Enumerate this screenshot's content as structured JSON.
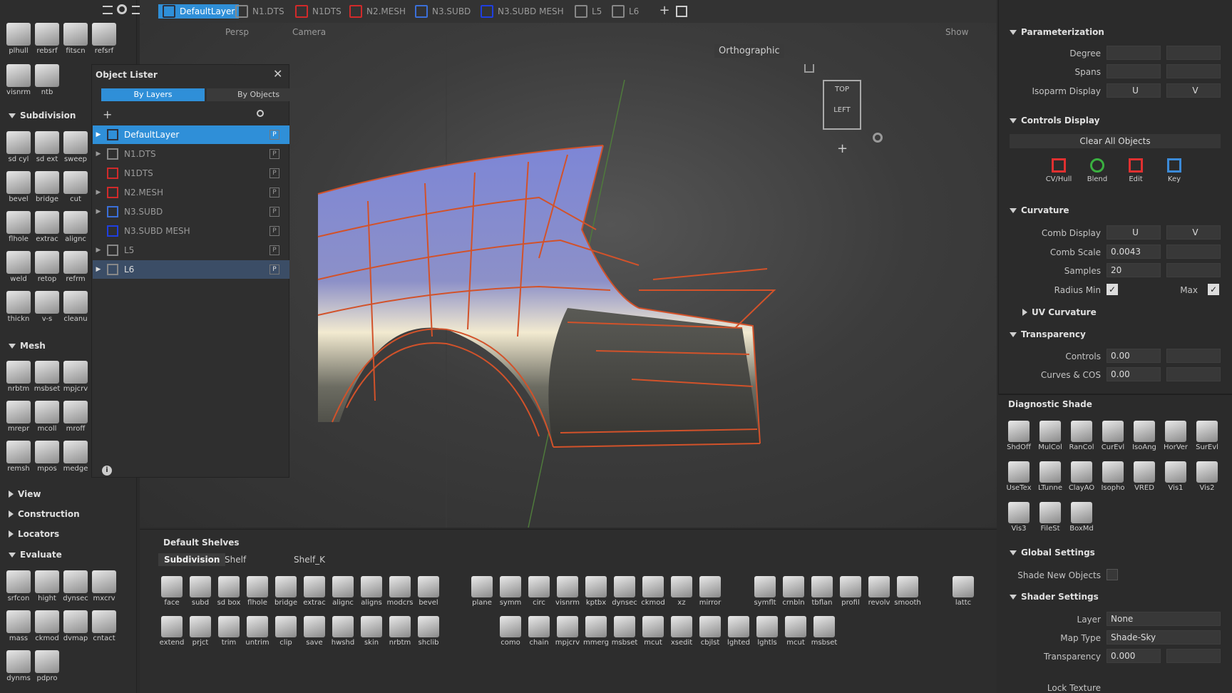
{
  "tabs": [
    {
      "label": "DefaultLayer",
      "color": "#2c2f3c",
      "active": true
    },
    {
      "label": "N1.DTS",
      "color": "#888888"
    },
    {
      "label": "N1DTS",
      "color": "#d12a2a"
    },
    {
      "label": "N2.MESH",
      "color": "#d12a2a"
    },
    {
      "label": "N3.SUBD",
      "color": "#3b6fd8"
    },
    {
      "label": "N3.SUBD MESH",
      "color": "#1f3fe0"
    },
    {
      "label": "L5",
      "color": "#888888"
    },
    {
      "label": "L6",
      "color": "#888888"
    }
  ],
  "viewport": {
    "persp": "Persp",
    "camera": "Camera",
    "show": "Show",
    "ortho": "Orthographic",
    "cube_top": "TOP",
    "cube_left": "LEFT"
  },
  "left_shelf": {
    "row1": [
      "plhull",
      "rebsrf",
      "fitscn",
      "refsrf"
    ],
    "row2": [
      "visnrm",
      "ntb"
    ],
    "subdivision_title": "Subdivision",
    "sub": [
      "sd cyl",
      "sd ext",
      "sweep",
      "bevel",
      "bridge",
      "cut",
      "flhole",
      "extrac",
      "alignc",
      "weld",
      "retop",
      "refrm",
      "thickn",
      "v-s",
      "cleanu"
    ],
    "mesh_title": "Mesh",
    "mesh": [
      "nrbtm",
      "msbset",
      "mpjcrv",
      "mrepr",
      "mcoll",
      "mroff",
      "remsh",
      "mpos",
      "medge"
    ],
    "view": "View",
    "construction": "Construction",
    "locators": "Locators",
    "evaluate_title": "Evaluate",
    "eval": [
      "srfcon",
      "hight",
      "dynsec",
      "mxcrv",
      "mass",
      "ckmod",
      "dvmap",
      "cntact",
      "dynms",
      "pdpro"
    ]
  },
  "lister": {
    "title": "Object Lister",
    "tab_layers": "By Layers",
    "tab_objects": "By Objects",
    "layers": [
      {
        "name": "DefaultLayer",
        "color": "#2c2f3c",
        "selected": true,
        "expand": true
      },
      {
        "name": "N1.DTS",
        "color": "#888888",
        "expand": true
      },
      {
        "name": "N1DTS",
        "color": "#d12a2a",
        "expand": false
      },
      {
        "name": "N2.MESH",
        "color": "#d12a2a",
        "expand": true
      },
      {
        "name": "N3.SUBD",
        "color": "#3b6fd8",
        "expand": true
      },
      {
        "name": "N3.SUBD MESH",
        "color": "#1f3fe0",
        "expand": false
      },
      {
        "name": "L5",
        "color": "#888888",
        "expand": true
      },
      {
        "name": "L6",
        "color": "#888888",
        "expand": true,
        "highlight": true
      }
    ],
    "p": "P"
  },
  "shelves": {
    "title": "Default Shelves",
    "tabs": [
      "Subdivision",
      "Shelf",
      "Shelf_K"
    ],
    "row1a": [
      "face",
      "subd",
      "sd box",
      "flhole",
      "bridge",
      "extrac",
      "alignc",
      "aligns",
      "modcrs",
      "bevel"
    ],
    "row2a": [
      "extend",
      "prjct",
      "trim",
      "untrim",
      "clip",
      "save",
      "hwshd",
      "skin",
      "nrbtm",
      "shclib"
    ],
    "row1b": [
      "plane",
      "symm",
      "circ",
      "visnrm",
      "kptbx",
      "dynsec",
      "ckmod",
      "xz",
      "mirror"
    ],
    "row2b": [
      "como",
      "chain",
      "mpjcrv",
      "mmerg",
      "msbset",
      "mcut",
      "xsedit",
      "cbjlst",
      "lghted",
      "lghtls",
      "mcut",
      "msbset"
    ],
    "row1c": [
      "symflt",
      "crnbln",
      "tbflan",
      "profil",
      "revolv",
      "smooth"
    ],
    "lattc": "lattc"
  },
  "props": {
    "param_title": "Parameterization",
    "degree": "Degree",
    "spans": "Spans",
    "isoparm": "Isoparm Display",
    "u": "U",
    "v": "V",
    "controls_title": "Controls Display",
    "clear": "Clear All Objects",
    "ctl": [
      "CV/Hull",
      "Blend",
      "Edit",
      "Key"
    ],
    "curv_title": "Curvature",
    "comb_display": "Comb Display",
    "comb_scale": "Comb Scale",
    "comb_scale_val": "0.0043",
    "samples": "Samples",
    "samples_val": "20",
    "radius_min": "Radius Min",
    "max": "Max",
    "uv_curv": "UV Curvature",
    "trans_title": "Transparency",
    "controls": "Controls",
    "controls_val": "0.00",
    "curves": "Curves & COS",
    "curves_val": "0.00"
  },
  "diag": {
    "title": "Diagnostic Shade",
    "row1": [
      "ShdOff",
      "MulCol",
      "RanCol",
      "CurEvl",
      "IsoAng",
      "HorVer",
      "SurEvl"
    ],
    "row2": [
      "UseTex",
      "LTunne",
      "ClayAO",
      "Isopho",
      "VRED",
      "Vis1",
      "Vis2"
    ],
    "row3": [
      "Vis3",
      "FileSt",
      "BoxMd"
    ],
    "global_title": "Global Settings",
    "shade_new": "Shade New Objects",
    "shader_title": "Shader Settings",
    "layer": "Layer",
    "layer_val": "None",
    "maptype": "Map Type",
    "maptype_val": "Shade-Sky",
    "transparency": "Transparency",
    "transparency_val": "0.000",
    "lock": "Lock Texture"
  }
}
